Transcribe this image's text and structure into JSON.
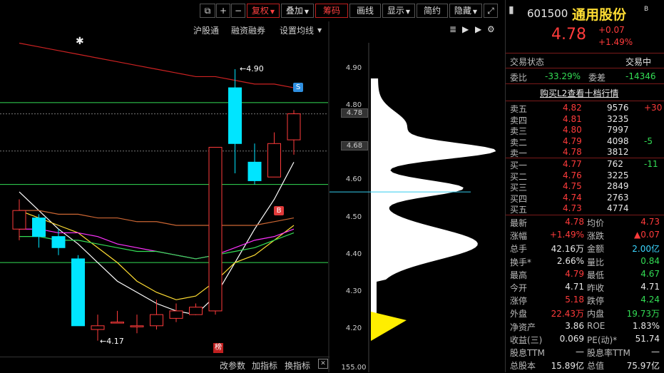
{
  "toolbar": {
    "plus": "+",
    "minus": "−",
    "fuquan": "复权",
    "diejia": "叠加",
    "chouma": "筹码",
    "huaxian": "画线",
    "xianshi": "显示",
    "jianyue": "简约",
    "yincang": "隐藏"
  },
  "subbar": {
    "hugutong": "沪股通",
    "rongzi": "融资融券",
    "shezhi": "设置均线"
  },
  "chart_annotations": {
    "high_label": "4.90",
    "low_label": "4.17",
    "s_marker": "S",
    "b_marker": "B",
    "bang": "榜",
    "star": "✱"
  },
  "price_axis": [
    "4.90",
    "4.80",
    "4.78",
    "4.68",
    "4.60",
    "4.50",
    "4.40",
    "4.30",
    "4.20",
    "155.00"
  ],
  "bottom_bar": {
    "gai": "改参数",
    "jia": "加指标",
    "huan": "换指标"
  },
  "chart_data": {
    "type": "candlestick",
    "ylim": [
      4.12,
      4.95
    ],
    "candles": [
      {
        "o": 4.47,
        "c": 4.52,
        "h": 4.55,
        "l": 4.44
      },
      {
        "o": 4.5,
        "c": 4.45,
        "h": 4.51,
        "l": 4.42
      },
      {
        "o": 4.45,
        "c": 4.42,
        "h": 4.47,
        "l": 4.4
      },
      {
        "o": 4.39,
        "c": 4.21,
        "h": 4.4,
        "l": 4.21
      },
      {
        "o": 4.2,
        "c": 4.21,
        "h": 4.24,
        "l": 4.17
      },
      {
        "o": 4.22,
        "c": 4.22,
        "h": 4.25,
        "l": 4.22
      },
      {
        "o": 4.21,
        "c": 4.21,
        "h": 4.24,
        "l": 4.19
      },
      {
        "o": 4.21,
        "c": 4.24,
        "h": 4.28,
        "l": 4.2
      },
      {
        "o": 4.23,
        "c": 4.25,
        "h": 4.27,
        "l": 4.22
      },
      {
        "o": 4.24,
        "c": 4.26,
        "h": 4.27,
        "l": 4.24
      },
      {
        "o": 4.25,
        "c": 4.69,
        "h": 4.69,
        "l": 4.24
      },
      {
        "o": 4.85,
        "c": 4.7,
        "h": 4.9,
        "l": 4.62
      },
      {
        "o": 4.65,
        "c": 4.6,
        "h": 4.7,
        "l": 4.59
      },
      {
        "o": 4.61,
        "c": 4.7,
        "h": 4.73,
        "l": 4.61
      },
      {
        "o": 4.71,
        "c": 4.78,
        "h": 4.79,
        "l": 4.67
      }
    ],
    "ma_series": [
      {
        "color": "#ffffff",
        "values": [
          4.57,
          4.52,
          4.47,
          4.43,
          4.38,
          4.33,
          4.3,
          4.27,
          4.25,
          4.24,
          4.29,
          4.38,
          4.47,
          4.55,
          4.65
        ]
      },
      {
        "color": "#ffdd33",
        "values": [
          4.52,
          4.5,
          4.48,
          4.46,
          4.42,
          4.38,
          4.33,
          4.3,
          4.28,
          4.29,
          4.33,
          4.38,
          4.4,
          4.44,
          4.48
        ]
      },
      {
        "color": "#ff33ff",
        "values": [
          4.47,
          4.47,
          4.46,
          4.46,
          4.45,
          4.43,
          4.42,
          4.41,
          4.4,
          4.39,
          4.4,
          4.42,
          4.44,
          4.45,
          4.47
        ]
      },
      {
        "color": "#33dd55",
        "values": [
          4.45,
          4.45,
          4.44,
          4.44,
          4.43,
          4.42,
          4.41,
          4.41,
          4.4,
          4.39,
          4.4,
          4.41,
          4.42,
          4.44,
          4.46
        ]
      },
      {
        "color": "#cc6633",
        "values": [
          4.52,
          4.52,
          4.51,
          4.51,
          4.5,
          4.5,
          4.49,
          4.49,
          4.48,
          4.48,
          4.48,
          4.48,
          4.48,
          4.49,
          4.5
        ]
      },
      {
        "color": "#cc2222",
        "values": [
          4.97,
          4.96,
          4.95,
          4.94,
          4.93,
          4.92,
          4.91,
          4.9,
          4.89,
          4.88,
          4.88,
          4.87,
          4.86,
          4.86,
          4.85
        ]
      }
    ],
    "hlines": [
      4.81,
      4.78,
      4.68,
      4.59,
      4.38
    ],
    "chip_profile_center": 4.57
  },
  "panel": {
    "code": "601500",
    "name": "通用股份",
    "b_tag": "B",
    "price": "4.78",
    "change": "+0.07",
    "change_pct": "+1.49%",
    "status_label": "交易状态",
    "status_value": "交易中",
    "weibi_label": "委比",
    "weibi_value": "-33.29%",
    "weicha_label": "委差",
    "weicha_value": "-14346",
    "l2_link": "购买L2查看十档行情",
    "asks": [
      {
        "label": "卖五",
        "price": "4.82",
        "vol": "9576",
        "chg": "+30"
      },
      {
        "label": "卖四",
        "price": "4.81",
        "vol": "3235",
        "chg": ""
      },
      {
        "label": "卖三",
        "price": "4.80",
        "vol": "7997",
        "chg": ""
      },
      {
        "label": "卖二",
        "price": "4.79",
        "vol": "4098",
        "chg": "-5"
      },
      {
        "label": "卖一",
        "price": "4.78",
        "vol": "3812",
        "chg": ""
      }
    ],
    "bids": [
      {
        "label": "买一",
        "price": "4.77",
        "vol": "762",
        "chg": "-11"
      },
      {
        "label": "买二",
        "price": "4.76",
        "vol": "3225",
        "chg": ""
      },
      {
        "label": "买三",
        "price": "4.75",
        "vol": "2849",
        "chg": ""
      },
      {
        "label": "买四",
        "price": "4.74",
        "vol": "2763",
        "chg": ""
      },
      {
        "label": "买五",
        "price": "4.73",
        "vol": "4774",
        "chg": ""
      }
    ],
    "stats": [
      {
        "l1": "最新",
        "v1": "4.78",
        "c1": "red",
        "l2": "均价",
        "v2": "4.73",
        "c2": "red"
      },
      {
        "l1": "涨幅",
        "v1": "+1.49%",
        "c1": "red",
        "l2": "涨跌",
        "v2": "▲0.07",
        "c2": "red"
      },
      {
        "l1": "总手",
        "v1": "42.16万",
        "c1": "white",
        "l2": "金额",
        "v2": "2.00亿",
        "c2": "cyan"
      },
      {
        "l1": "换手*",
        "v1": "2.66%",
        "c1": "white",
        "l2": "量比",
        "v2": "0.84",
        "c2": "green"
      },
      {
        "l1": "最高",
        "v1": "4.79",
        "c1": "red",
        "l2": "最低",
        "v2": "4.67",
        "c2": "green"
      },
      {
        "l1": "今开",
        "v1": "4.71",
        "c1": "white",
        "l2": "昨收",
        "v2": "4.71",
        "c2": "white"
      },
      {
        "l1": "涨停",
        "v1": "5.18",
        "c1": "red",
        "l2": "跌停",
        "v2": "4.24",
        "c2": "green"
      },
      {
        "l1": "外盘",
        "v1": "22.43万",
        "c1": "red",
        "l2": "内盘",
        "v2": "19.73万",
        "c2": "green"
      },
      {
        "l1": "净资产",
        "v1": "3.86",
        "c1": "white",
        "l2": "ROE",
        "v2": "1.83%",
        "c2": "white"
      },
      {
        "l1": "收益(三)",
        "v1": "0.069",
        "c1": "white",
        "l2": "PE(动)*",
        "v2": "51.74",
        "c2": "white"
      },
      {
        "l1": "股息TTM",
        "v1": "—",
        "c1": "white",
        "l2": "股息率TTM",
        "v2": "—",
        "c2": "white"
      },
      {
        "l1": "总股本",
        "v1": "15.89亿",
        "c1": "white",
        "l2": "总值",
        "v2": "75.97亿",
        "c2": "white"
      }
    ]
  }
}
